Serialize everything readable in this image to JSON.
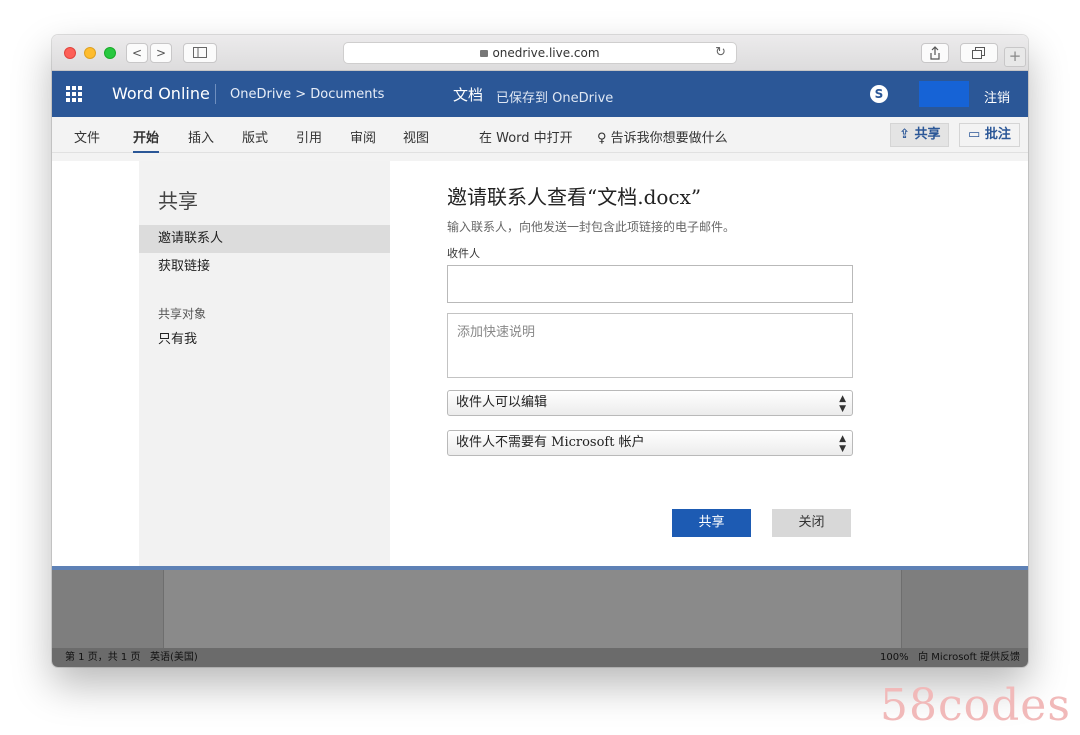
{
  "browser": {
    "url": "onedrive.live.com",
    "back": "<",
    "forward": ">",
    "reload": "↻",
    "new_tab": "+"
  },
  "word": {
    "app_name": "Word Online",
    "breadcrumb": "OneDrive > Documents",
    "doc_name": "文档",
    "save_status": "已保存到 OneDrive",
    "logout": "注销"
  },
  "ribbon": {
    "tabs": [
      "文件",
      "开始",
      "插入",
      "版式",
      "引用",
      "审阅",
      "视图"
    ],
    "open_in_word": "在 Word 中打开",
    "tell_me": "告诉我你想要做什么",
    "share_label": "共享",
    "comment_label": "批注"
  },
  "share_dialog": {
    "title": "共享",
    "nav": [
      "邀请联系人",
      "获取链接"
    ],
    "shared_with_label": "共享对象",
    "shared_with_value": "只有我",
    "heading": "邀请联系人查看“文档.docx”",
    "subtitle": "输入联系人，向他发送一封包含此项链接的电子邮件。",
    "to_label": "收件人",
    "to_value": "",
    "note_placeholder": "添加快速说明",
    "permission_select": "收件人可以编辑",
    "account_select": "收件人不需要有 Microsoft 帐户",
    "share_button": "共享",
    "close_button": "关闭"
  },
  "statusbar": {
    "page": "第 1 页，共 1 页",
    "language": "英语(美国)",
    "zoom": "100%",
    "feedback": "向 Microsoft 提供反馈"
  },
  "watermark": "58codes"
}
